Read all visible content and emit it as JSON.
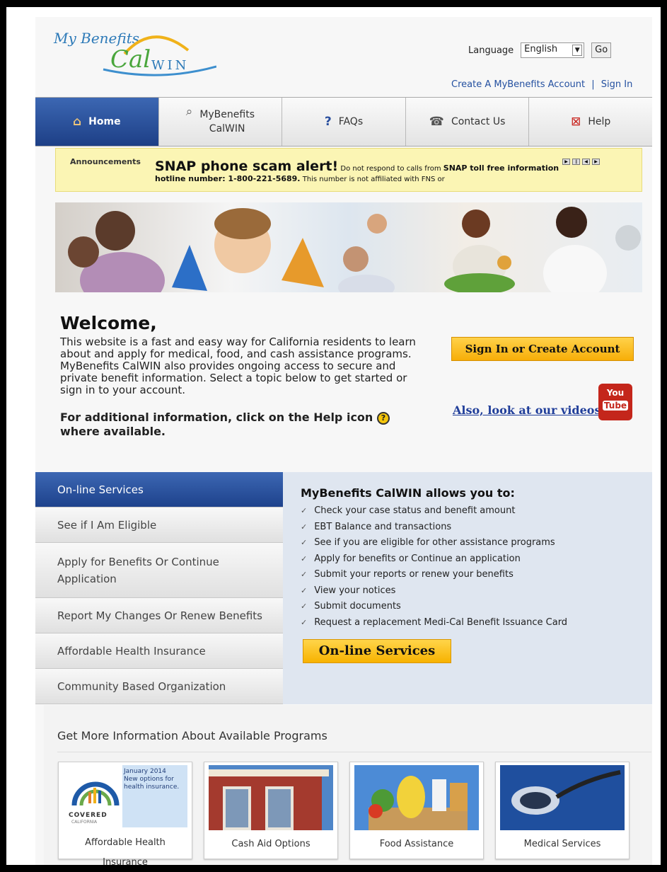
{
  "header": {
    "logo_my": "My Benefits",
    "logo_cal": "Cal",
    "logo_win": "WIN",
    "language_label": "Language",
    "language_value": "English",
    "go_label": "Go",
    "create_account": "Create A MyBenefits Account",
    "separator": "|",
    "sign_in": "Sign In"
  },
  "nav": {
    "home": "Home",
    "mybenefits_line1": "MyBenefits",
    "mybenefits_line2": "CalWIN",
    "faqs": "FAQs",
    "contact": "Contact Us",
    "help": "Help"
  },
  "announcement": {
    "label": "Announcements",
    "headline": "SNAP phone scam alert!",
    "text1": "Do not respond to calls from",
    "bold1": "SNAP toll free information hotline number: 1-800-221-5689.",
    "text2": "This number is not affiliated with FNS or"
  },
  "welcome": {
    "title": "Welcome,",
    "body": "This website is a fast and easy way for California residents to learn about and apply for medical, food, and cash assistance programs. MyBenefits CalWIN also provides ongoing access to secure and private benefit information. Select a topic below to get started or sign in to your account.",
    "help_pre": "For additional information, click on the Help icon",
    "help_post": "where available."
  },
  "signin_button": "Sign In or Create Account",
  "videos_link": "Also, look at our videos",
  "youtube": {
    "line1": "You",
    "line2": "Tube"
  },
  "sidebar": {
    "items": [
      {
        "label": "On-line Services"
      },
      {
        "label": "See if I Am Eligible"
      },
      {
        "label": "Apply for Benefits Or Continue Application"
      },
      {
        "label": "Report My Changes Or Renew Benefits"
      },
      {
        "label": "Affordable Health Insurance"
      },
      {
        "label": "Community Based Organization"
      }
    ]
  },
  "allow": {
    "title": "MyBenefits CalWIN allows you to:",
    "items": [
      "Check your case status and benefit amount",
      "EBT Balance and transactions",
      "See if you are eligible for other assistance programs",
      "Apply for benefits or Continue an application",
      "Submit your reports or renew your benefits",
      "View your notices",
      "Submit documents",
      "Request a replacement Medi-Cal Benefit Issuance Card"
    ],
    "button": "On-line Services"
  },
  "programs": {
    "title": "Get More Information About Available Programs",
    "covered_date": "January 2014",
    "covered_note": "New options for health insurance.",
    "covered_brand": "COVERED",
    "covered_sub": "CALIFORNIA",
    "cards": [
      {
        "label": "Affordable Health Insurance"
      },
      {
        "label": "Cash Aid Options"
      },
      {
        "label": "Food Assistance"
      },
      {
        "label": "Medical Services"
      }
    ]
  },
  "colors": {
    "nav_active": "#2a4f9e",
    "button_yellow": "#f7b200",
    "link_blue": "#2450a0"
  }
}
